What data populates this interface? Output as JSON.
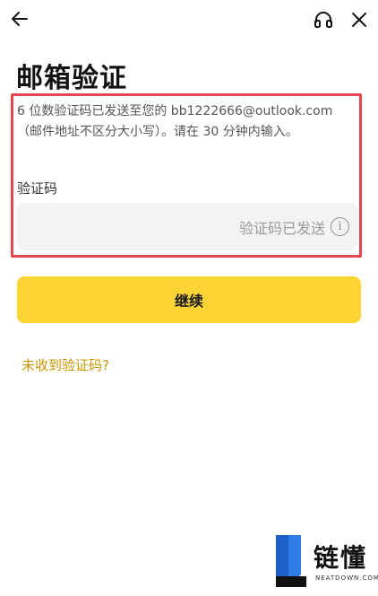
{
  "header": {
    "back_icon": "arrow-left-icon",
    "support_icon": "headset-icon",
    "close_icon": "close-icon"
  },
  "page": {
    "title": "邮箱验证",
    "description_line1": "6 位数验证码已发送至您的 bb1222666@outlook.com",
    "description_line2": "（邮件地址不区分大小写）。请在 30 分钟内输入。",
    "code_label": "验证码",
    "code_value": "",
    "code_status": "验证码已发送",
    "continue_label": "继续",
    "resend_link": "未收到验证码?"
  },
  "watermark": {
    "text": "链懂",
    "sub": "NEATDOWN.COM"
  },
  "colors": {
    "accent": "#fcd535",
    "link": "#c99400",
    "highlight": "#e3484e"
  }
}
